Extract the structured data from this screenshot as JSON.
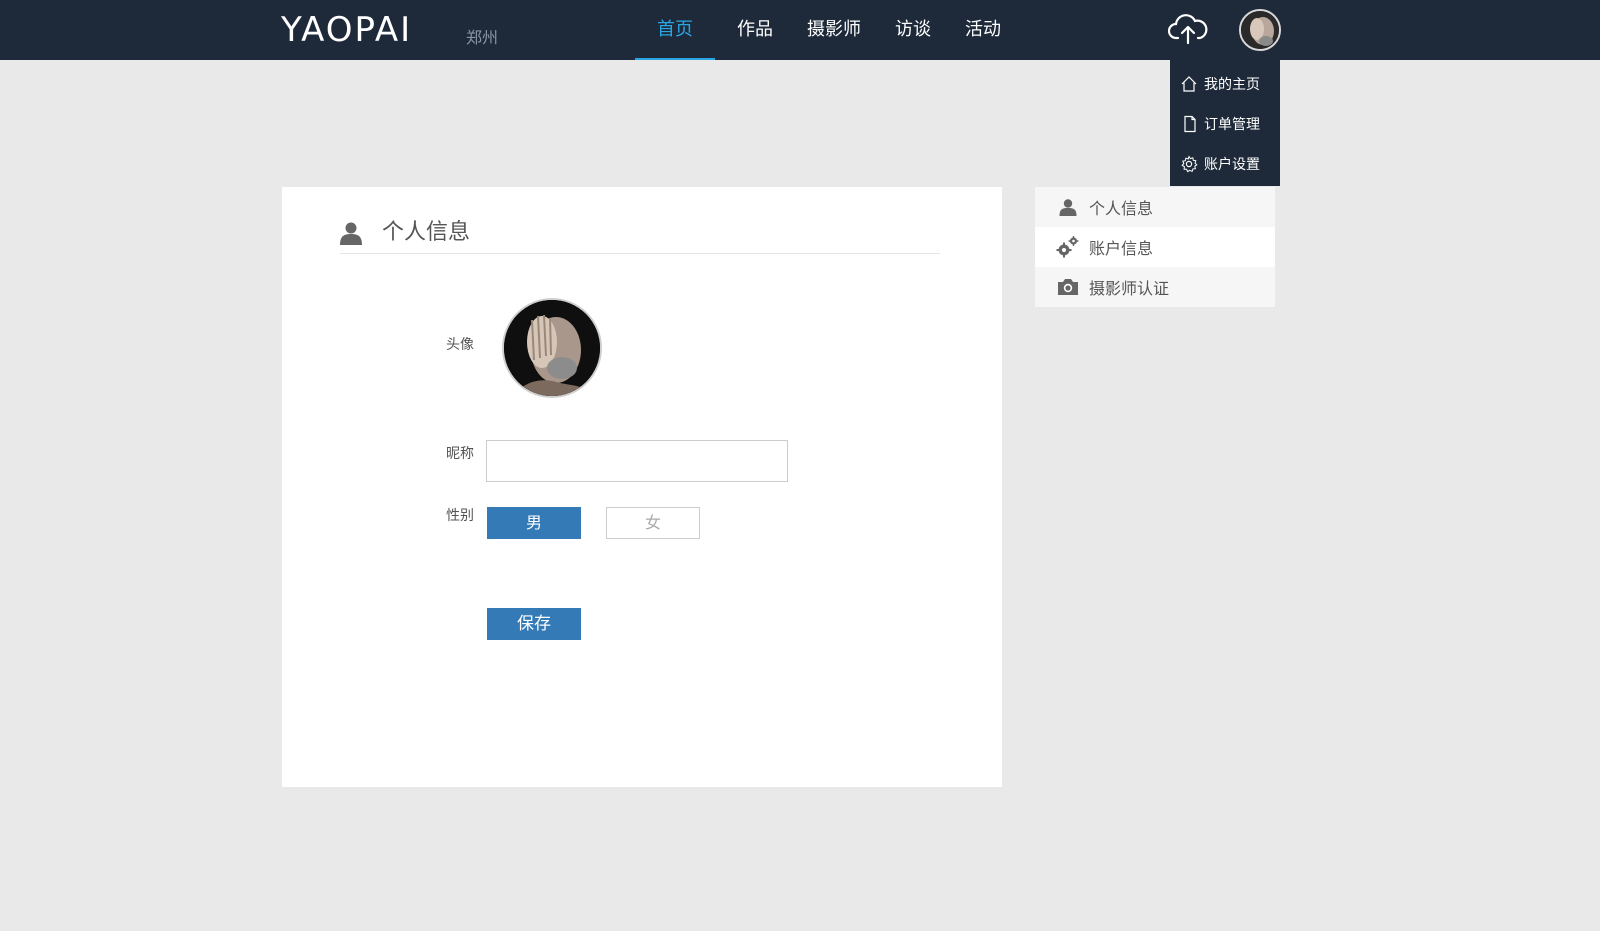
{
  "header": {
    "logo": "YAOPAI",
    "city": "郑州",
    "nav": [
      {
        "label": "首页",
        "active": true
      },
      {
        "label": "作品",
        "active": false
      },
      {
        "label": "摄影师",
        "active": false
      },
      {
        "label": "访谈",
        "active": false
      },
      {
        "label": "活动",
        "active": false
      }
    ],
    "upload_icon": "cloud-upload-icon",
    "accent_color": "#2aa6e6",
    "bg_color": "#1e2a3a"
  },
  "user_menu": {
    "items": [
      {
        "label": "我的主页",
        "icon": "home-icon"
      },
      {
        "label": "订单管理",
        "icon": "document-icon"
      },
      {
        "label": "账户设置",
        "icon": "gear-icon"
      }
    ]
  },
  "profile": {
    "title": "个人信息",
    "avatar_label": "头像",
    "nickname_label": "昵称",
    "nickname_value": "",
    "nickname_placeholder": "",
    "gender_label": "性别",
    "gender_options": [
      "男",
      "女"
    ],
    "gender_selected": "男",
    "save_label": "保存",
    "primary_color": "#337ab7"
  },
  "sidebar": {
    "items": [
      {
        "label": "个人信息",
        "icon": "user-icon"
      },
      {
        "label": "账户信息",
        "icon": "gears-icon"
      },
      {
        "label": "摄影师认证",
        "icon": "camera-icon"
      }
    ]
  }
}
